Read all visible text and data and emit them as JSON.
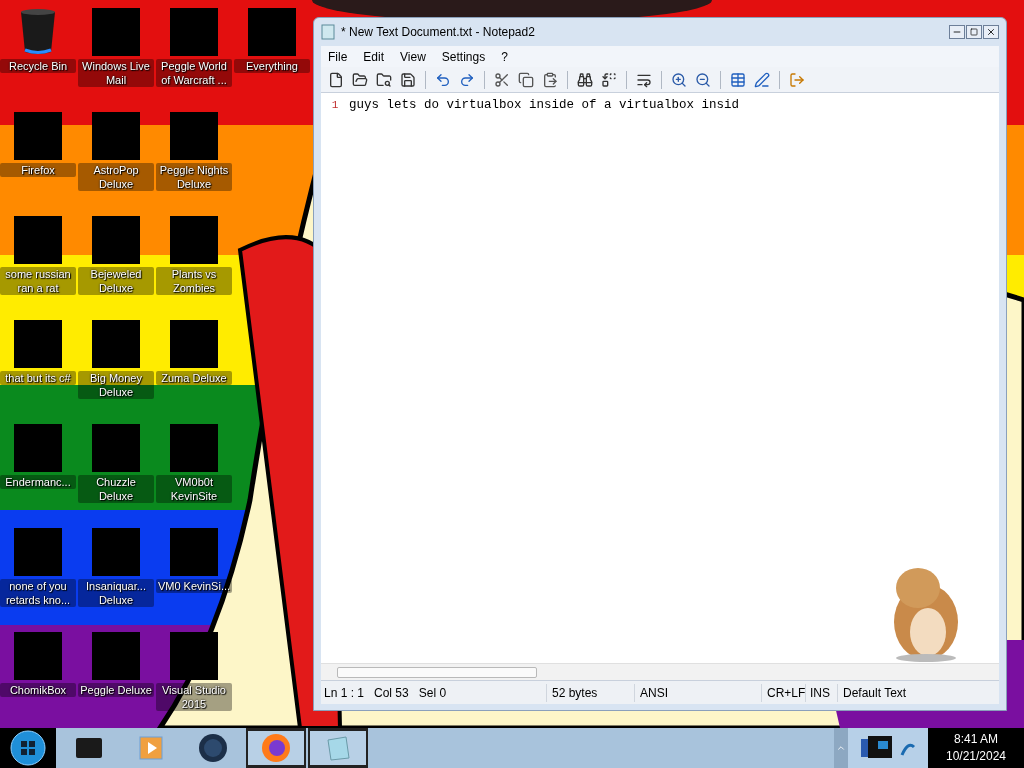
{
  "desktop": {
    "columns": [
      {
        "icons": [
          {
            "label": "Recycle Bin",
            "kind": "bin"
          },
          {
            "label": "Firefox",
            "kind": "covered"
          },
          {
            "label": "some russian ran a rat",
            "kind": "covered"
          },
          {
            "label": "that but its c#",
            "kind": "covered"
          },
          {
            "label": "Endermanc...",
            "kind": "covered"
          },
          {
            "label": "none of you retards kno...",
            "kind": "covered"
          },
          {
            "label": "ChomikBox",
            "kind": "covered"
          }
        ]
      },
      {
        "icons": [
          {
            "label": "Windows Live Mail",
            "kind": "covered"
          },
          {
            "label": "AstroPop Deluxe",
            "kind": "covered"
          },
          {
            "label": "Bejeweled Deluxe",
            "kind": "covered"
          },
          {
            "label": "Big Money Deluxe",
            "kind": "covered"
          },
          {
            "label": "Chuzzle Deluxe",
            "kind": "covered"
          },
          {
            "label": "Insaniquar... Deluxe",
            "kind": "covered"
          },
          {
            "label": "Peggle Deluxe",
            "kind": "covered"
          }
        ]
      },
      {
        "icons": [
          {
            "label": "Peggle World of Warcraft ...",
            "kind": "covered"
          },
          {
            "label": "Peggle Nights Deluxe",
            "kind": "covered"
          },
          {
            "label": "Plants vs Zombies",
            "kind": "covered"
          },
          {
            "label": "Zuma Deluxe",
            "kind": "covered"
          },
          {
            "label": "VM0b0t KevinSite",
            "kind": "covered"
          },
          {
            "label": "VM0 KevinSi...",
            "kind": "covered"
          },
          {
            "label": "Visual Studio 2015",
            "kind": "covered"
          }
        ]
      },
      {
        "icons": [
          {
            "label": "Everything",
            "kind": "covered"
          }
        ]
      }
    ]
  },
  "window": {
    "title": "* New Text Document.txt - Notepad2",
    "menu": [
      "File",
      "Edit",
      "View",
      "Settings",
      "?"
    ],
    "lines": [
      {
        "number": "1",
        "text": "guys lets do virtualbox inside of a virtualbox insid"
      }
    ],
    "status_bar": {
      "position": [
        "Ln 1 : 1",
        "Col 53",
        "Sel 0"
      ],
      "size": "52 bytes",
      "encoding": "ANSI",
      "line_endings": "CR+LF",
      "mode": "INS",
      "scheme": "Default Text"
    }
  },
  "taskbar": {
    "items": [
      {
        "kind": "box",
        "selected": false
      },
      {
        "kind": "player",
        "selected": false
      },
      {
        "kind": "globe",
        "selected": false
      },
      {
        "kind": "firefox",
        "selected": true
      },
      {
        "kind": "notepad",
        "selected": true
      }
    ],
    "clock": {
      "time": "8:41 AM",
      "date": "10/21/2024"
    }
  }
}
